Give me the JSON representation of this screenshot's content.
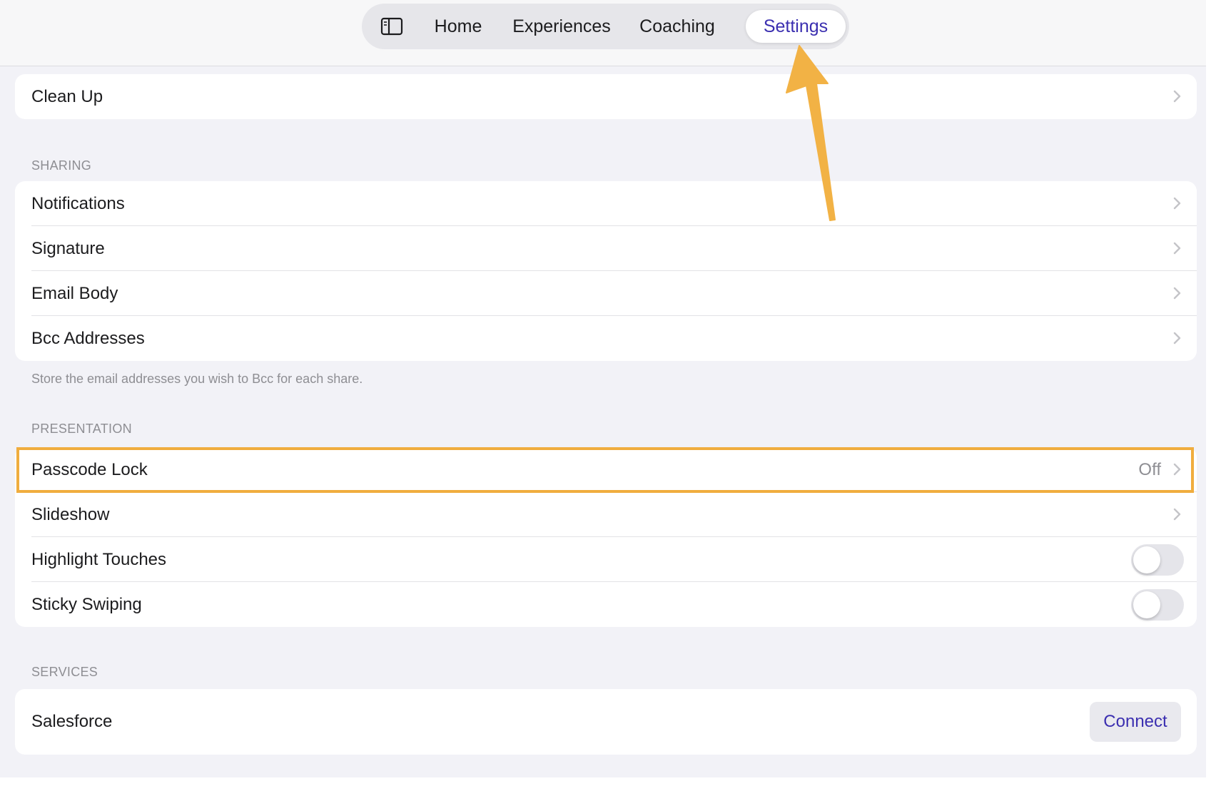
{
  "nav": {
    "tabs": [
      {
        "label": "Home"
      },
      {
        "label": "Experiences"
      },
      {
        "label": "Coaching"
      },
      {
        "label": "Settings"
      }
    ],
    "active_tab": "Settings"
  },
  "top_group": {
    "items": [
      {
        "label": "Clean Up"
      }
    ]
  },
  "sharing": {
    "header": "SHARING",
    "items": [
      {
        "label": "Notifications"
      },
      {
        "label": "Signature"
      },
      {
        "label": "Email Body"
      },
      {
        "label": "Bcc Addresses"
      }
    ],
    "footer": "Store the email addresses you wish to Bcc for each share."
  },
  "presentation": {
    "header": "PRESENTATION",
    "items": [
      {
        "label": "Passcode Lock",
        "value": "Off"
      },
      {
        "label": "Slideshow"
      },
      {
        "label": "Highlight Touches",
        "toggle_on": false
      },
      {
        "label": "Sticky Swiping",
        "toggle_on": false
      }
    ]
  },
  "services": {
    "header": "SERVICES",
    "items": [
      {
        "label": "Salesforce",
        "action": "Connect"
      }
    ]
  },
  "colors": {
    "accent": "#3b2fb0",
    "highlight": "#f0ad3e",
    "annotation_arrow": "#f2b245"
  }
}
